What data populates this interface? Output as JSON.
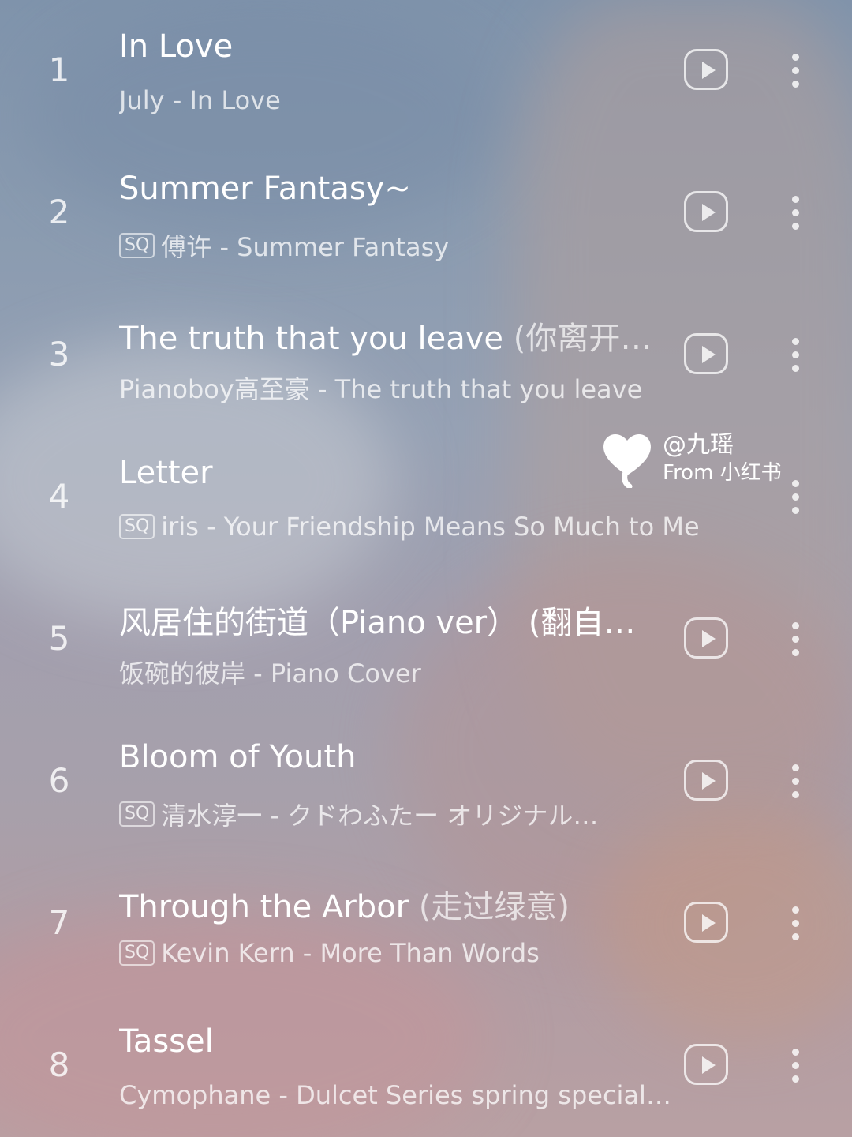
{
  "playlist": [
    {
      "index": "1",
      "title": "In Love",
      "title_extra": "",
      "sq": "",
      "subtitle": "July - In Love"
    },
    {
      "index": "2",
      "title": "Summer Fantasy~",
      "title_extra": "",
      "sq": "SQ",
      "subtitle": "傅许 - Summer Fantasy"
    },
    {
      "index": "3",
      "title": "The truth that you leave ",
      "title_extra": "(你离开…",
      "sq": "",
      "subtitle": "Pianoboy高至豪 - The truth that you leave"
    },
    {
      "index": "4",
      "title": "Letter",
      "title_extra": "",
      "sq": "SQ",
      "subtitle": "iris - Your Friendship Means So Much to Me"
    },
    {
      "index": "5",
      "title": "风居住的街道（Piano ver） (翻自…",
      "title_extra": "",
      "sq": "",
      "subtitle": "饭碗的彼岸 - Piano Cover"
    },
    {
      "index": "6",
      "title": "Bloom of Youth",
      "title_extra": "",
      "sq": "SQ",
      "subtitle": "清水淳一 - クドわふたー オリジナル…"
    },
    {
      "index": "7",
      "title": "Through the Arbor ",
      "title_extra": "(走过绿意)",
      "sq": "SQ",
      "subtitle": "Kevin Kern - More Than Words"
    },
    {
      "index": "8",
      "title": "Tassel",
      "title_extra": "",
      "sq": "",
      "subtitle": "Cymophane - Dulcet Series spring special…"
    }
  ],
  "icons": {
    "play": "play-icon",
    "more": "more-vertical-icon",
    "logo": "heart-logo-icon"
  },
  "watermark": {
    "user": "@九瑶",
    "source": "From 小红书"
  },
  "colors": {
    "text": "#ffffff",
    "badge_border": "rgba(255,255,255,0.6)"
  }
}
